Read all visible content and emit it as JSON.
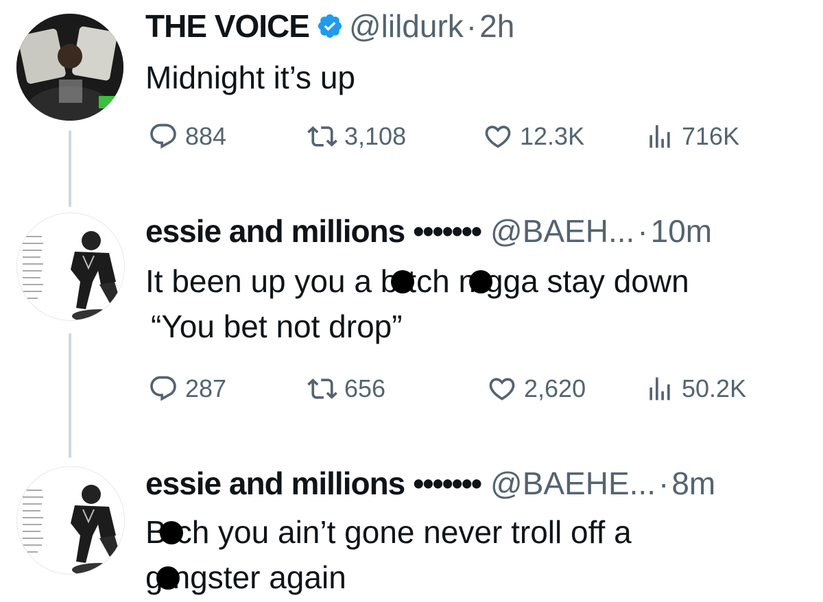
{
  "tweets": [
    {
      "name": "THE VOICE",
      "verified": true,
      "handle": "@lildurk",
      "separator": "·",
      "time": "2h",
      "text_lines": [
        "Midnight it’s up"
      ],
      "stats": {
        "replies": "884",
        "retweets": "3,108",
        "likes": "12.3K",
        "views": "716K"
      }
    },
    {
      "name": "essie and millions",
      "dots": "•••••••",
      "handle": "@BAEH...",
      "separator": "·",
      "time": "10m",
      "text": {
        "l1a": "It been up you a b",
        "l1b": "tch n",
        "l1c": "gga stay down",
        "l2": "“You bet not drop”"
      },
      "stats": {
        "replies": "287",
        "retweets": "656",
        "likes": "2,620",
        "views": "50.2K"
      }
    },
    {
      "name": "essie and millions",
      "dots": "•••••••",
      "handle": "@BAEHE...",
      "separator": "·",
      "time": "8m",
      "text": {
        "l1a": "B",
        "l1b": "ch you ain’t gone never troll off a",
        "l2a": "g",
        "l2b": "ngster again"
      }
    }
  ],
  "colors": {
    "text": "#0f1419",
    "secondary": "#536471",
    "verified": "#1d9bf0",
    "thread_line": "#cfd9de"
  }
}
